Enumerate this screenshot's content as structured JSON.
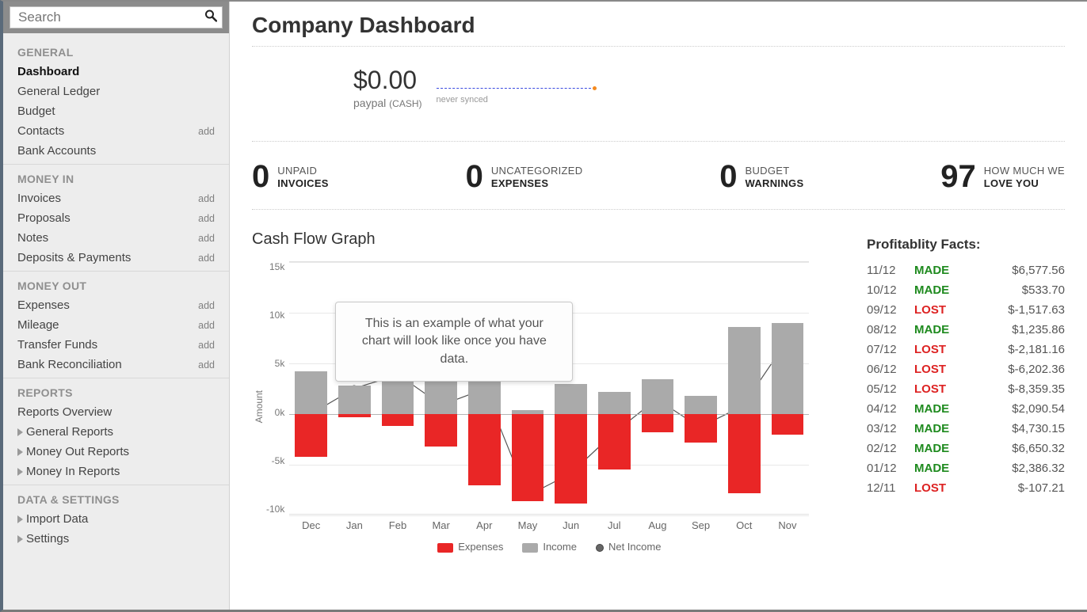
{
  "search": {
    "placeholder": "Search"
  },
  "sidebar": {
    "sections": [
      {
        "header": "GENERAL",
        "items": [
          {
            "label": "Dashboard",
            "add": "",
            "active": true
          },
          {
            "label": "General Ledger",
            "add": ""
          },
          {
            "label": "Budget",
            "add": ""
          },
          {
            "label": "Contacts",
            "add": "add"
          },
          {
            "label": "Bank Accounts",
            "add": ""
          }
        ]
      },
      {
        "header": "MONEY IN",
        "items": [
          {
            "label": "Invoices",
            "add": "add"
          },
          {
            "label": "Proposals",
            "add": "add"
          },
          {
            "label": "Notes",
            "add": "add"
          },
          {
            "label": "Deposits & Payments",
            "add": "add"
          }
        ]
      },
      {
        "header": "MONEY OUT",
        "items": [
          {
            "label": "Expenses",
            "add": "add"
          },
          {
            "label": "Mileage",
            "add": "add"
          },
          {
            "label": "Transfer Funds",
            "add": "add"
          },
          {
            "label": "Bank Reconciliation",
            "add": "add"
          }
        ]
      },
      {
        "header": "REPORTS",
        "items": [
          {
            "label": "Reports Overview",
            "add": ""
          }
        ],
        "subitems": [
          {
            "label": "General Reports"
          },
          {
            "label": "Money Out Reports"
          },
          {
            "label": "Money In Reports"
          }
        ]
      },
      {
        "header": "DATA & SETTINGS",
        "subitems": [
          {
            "label": "Import Data"
          },
          {
            "label": "Settings"
          }
        ]
      }
    ]
  },
  "page_title": "Company Dashboard",
  "balance": {
    "amount": "$0.00",
    "account": "paypal",
    "type": "(CASH)",
    "synced": "never synced"
  },
  "stats": [
    {
      "num": "0",
      "line1": "UNPAID",
      "line2": "INVOICES"
    },
    {
      "num": "0",
      "line1": "UNCATEGORIZED",
      "line2": "EXPENSES"
    },
    {
      "num": "0",
      "line1": "BUDGET",
      "line2": "WARNINGS"
    },
    {
      "num": "97",
      "line1": "HOW MUCH WE",
      "line2": "LOVE YOU"
    }
  ],
  "chart": {
    "title": "Cash Flow Graph",
    "ylabel": "Amount",
    "yticks": [
      "15k",
      "10k",
      "5k",
      "0k",
      "-5k",
      "-10k"
    ],
    "tooltip": "This is an example of what your chart will look like once you have data.",
    "legend": {
      "expenses": "Expenses",
      "income": "Income",
      "net": "Net Income"
    }
  },
  "chart_data": {
    "type": "bar",
    "categories": [
      "Dec",
      "Jan",
      "Feb",
      "Mar",
      "Apr",
      "May",
      "Jun",
      "Jul",
      "Aug",
      "Sep",
      "Oct",
      "Nov"
    ],
    "series": [
      {
        "name": "Income",
        "values": [
          4.2,
          2.8,
          5.0,
          4.0,
          6.0,
          0.4,
          3.0,
          2.2,
          3.4,
          1.8,
          8.6,
          9.0
        ]
      },
      {
        "name": "Expenses",
        "values": [
          -4.2,
          -0.3,
          -1.2,
          -3.2,
          -7.0,
          -8.6,
          -8.8,
          -5.5,
          -1.8,
          -2.8,
          -7.8,
          -2.0
        ]
      },
      {
        "name": "Net Income",
        "values": [
          0.0,
          2.5,
          3.8,
          0.8,
          2.4,
          -8.2,
          -6.0,
          -2.0,
          1.4,
          -1.4,
          0.7,
          7.0
        ]
      }
    ],
    "title": "Cash Flow Graph",
    "xlabel": "",
    "ylabel": "Amount",
    "ylim": [
      -10,
      15
    ]
  },
  "profitability": {
    "title": "Profitablity Facts:",
    "rows": [
      {
        "date": "11/12",
        "status": "MADE",
        "amount": "$6,577.56"
      },
      {
        "date": "10/12",
        "status": "MADE",
        "amount": "$533.70"
      },
      {
        "date": "09/12",
        "status": "LOST",
        "amount": "$-1,517.63"
      },
      {
        "date": "08/12",
        "status": "MADE",
        "amount": "$1,235.86"
      },
      {
        "date": "07/12",
        "status": "LOST",
        "amount": "$-2,181.16"
      },
      {
        "date": "06/12",
        "status": "LOST",
        "amount": "$-6,202.36"
      },
      {
        "date": "05/12",
        "status": "LOST",
        "amount": "$-8,359.35"
      },
      {
        "date": "04/12",
        "status": "MADE",
        "amount": "$2,090.54"
      },
      {
        "date": "03/12",
        "status": "MADE",
        "amount": "$4,730.15"
      },
      {
        "date": "02/12",
        "status": "MADE",
        "amount": "$6,650.32"
      },
      {
        "date": "01/12",
        "status": "MADE",
        "amount": "$2,386.32"
      },
      {
        "date": "12/11",
        "status": "LOST",
        "amount": "$-107.21"
      }
    ]
  }
}
